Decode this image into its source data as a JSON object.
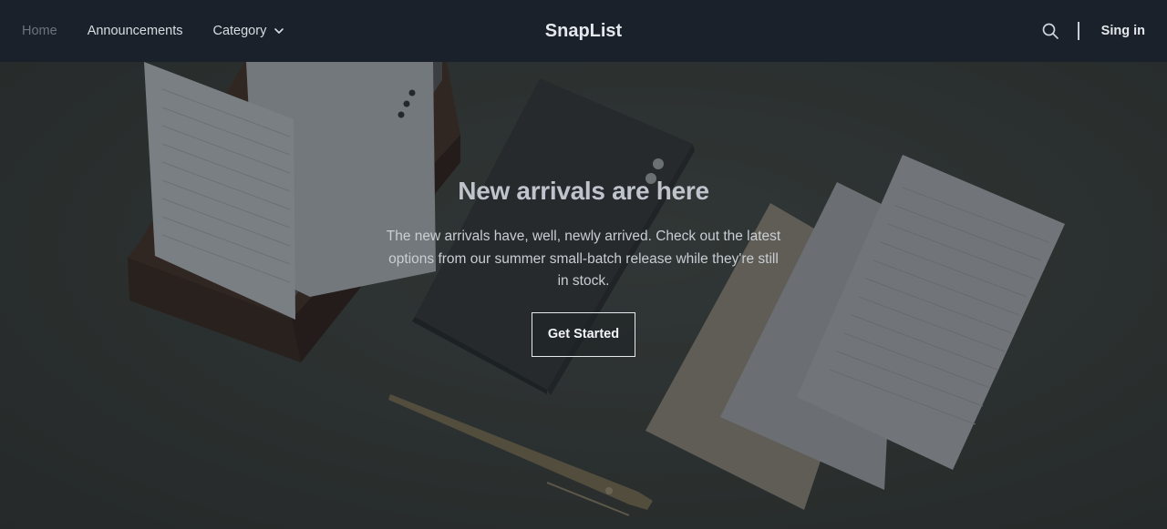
{
  "nav": {
    "links": [
      {
        "label": "Home",
        "active": true
      },
      {
        "label": "Announcements",
        "active": false
      },
      {
        "label": "Category",
        "active": false,
        "dropdown": true
      }
    ],
    "brand": "SnapList",
    "search_icon": "search-icon",
    "signin_label": "Sing in"
  },
  "hero": {
    "title": "New arrivals are here",
    "text": "The new arrivals have, well, newly arrived. Check out the latest options from our summer small-batch release while they're still in stock.",
    "button_label": "Get Started"
  },
  "colors": {
    "navbar_bg": "#1a212a",
    "hero_bg": "#323634",
    "active_link": "#6c7480"
  }
}
